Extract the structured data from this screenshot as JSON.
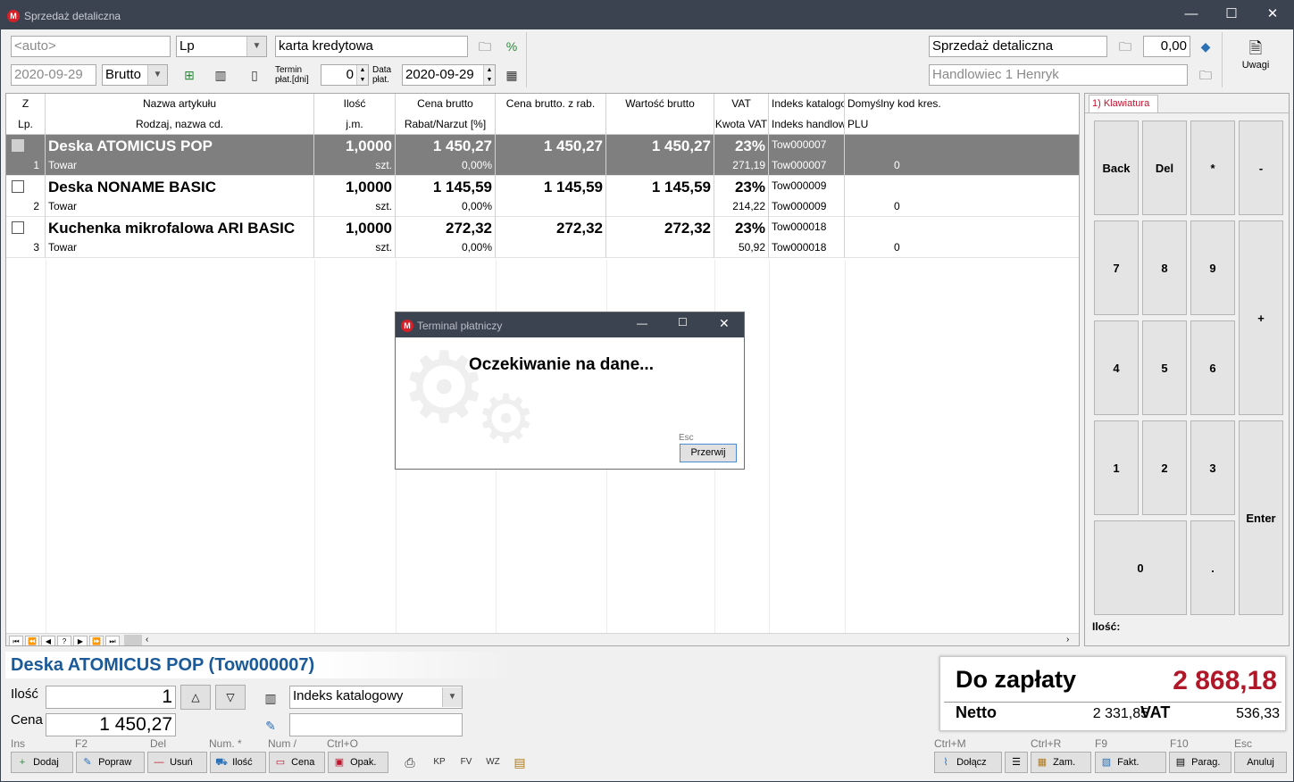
{
  "window": {
    "title": "Sprzedaż detaliczna",
    "logo": "M"
  },
  "header": {
    "number_placeholder": "<auto>",
    "sort_value": "Lp",
    "payment": "karta kredytowa",
    "date": "2020-09-29",
    "price_mode": "Brutto",
    "term_label": "Termin płat.[dni]",
    "term_value": "0",
    "date_pay_label": "Data płat.",
    "date_pay": "2020-09-29",
    "doc_type": "Sprzedaż detaliczna",
    "amount": "0,00",
    "seller": "Handlowiec 1 Henryk",
    "notes_label": "Uwagi"
  },
  "grid": {
    "headers": [
      [
        "Z",
        "Lp."
      ],
      [
        "Nazwa artykułu",
        "Rodzaj, nazwa cd."
      ],
      [
        "Ilość",
        "j.m."
      ],
      [
        "Cena brutto",
        "Rabat/Narzut [%]"
      ],
      [
        "Cena brutto. z rab.",
        ""
      ],
      [
        "Wartość brutto",
        ""
      ],
      [
        "VAT",
        "Kwota VAT"
      ],
      [
        "Indeks katalogowy",
        "Indeks handlowy"
      ],
      [
        "Domyślny kod kres.",
        "PLU"
      ]
    ],
    "rows": [
      {
        "lp": "1",
        "name": "Deska ATOMICUS POP",
        "kind": "Towar",
        "qty": "1,0000",
        "unit": "szt.",
        "price": "1 450,27",
        "disc": "0,00%",
        "price_disc": "1 450,27",
        "value": "1 450,27",
        "vat": "23%",
        "vat_amt": "271,19",
        "idx_cat": "Tow000007",
        "idx_trade": "Tow000007",
        "plu": "0"
      },
      {
        "lp": "2",
        "name": "Deska NONAME BASIC",
        "kind": "Towar",
        "qty": "1,0000",
        "unit": "szt.",
        "price": "1 145,59",
        "disc": "0,00%",
        "price_disc": "1 145,59",
        "value": "1 145,59",
        "vat": "23%",
        "vat_amt": "214,22",
        "idx_cat": "Tow000009",
        "idx_trade": "Tow000009",
        "plu": "0"
      },
      {
        "lp": "3",
        "name": "Kuchenka mikrofalowa ARI BASIC",
        "kind": "Towar",
        "qty": "1,0000",
        "unit": "szt.",
        "price": "272,32",
        "disc": "0,00%",
        "price_disc": "272,32",
        "value": "272,32",
        "vat": "23%",
        "vat_amt": "50,92",
        "idx_cat": "Tow000018",
        "idx_trade": "Tow000018",
        "plu": "0"
      }
    ],
    "nav": [
      "⏮",
      "⏪",
      "◀",
      "?",
      "▶",
      "⏩",
      "⏭"
    ]
  },
  "keypad": {
    "tab": "1) Klawiatura",
    "keys": [
      "Back",
      "Del",
      "*",
      "-",
      "7",
      "8",
      "9",
      "+",
      "4",
      "5",
      "6",
      "1",
      "2",
      "3",
      "Enter",
      "0",
      "."
    ],
    "qty_label": "Ilość:"
  },
  "dialog": {
    "title": "Terminal płatniczy",
    "message": "Oczekiwanie na dane...",
    "esc": "Esc",
    "button": "Przerwij"
  },
  "detail": {
    "title": "Deska ATOMICUS POP (Tow000007)",
    "qty_label": "Ilość",
    "qty": "1",
    "price_label": "Cena",
    "price": "1 450,27",
    "search_mode": "Indeks katalogowy"
  },
  "totals": {
    "due_label": "Do zapłaty",
    "due": "2 868,18",
    "net_label": "Netto",
    "net": "2 331,85",
    "vat_label": "VAT",
    "vat": "536,33"
  },
  "toolbar": {
    "shortcuts": [
      "Ins",
      "F2",
      "Del",
      "Num. *",
      "Num /",
      "Ctrl+O"
    ],
    "buttons": [
      "Dodaj",
      "Popraw",
      "Usuń",
      "Ilość",
      "Cena",
      "Opak."
    ],
    "right_shortcuts": [
      "Ctrl+M",
      "Ctrl+R",
      "F9",
      "F10",
      "Esc"
    ],
    "right_buttons": [
      "Dołącz",
      "Zam.",
      "Fakt.",
      "Parag.",
      "Anuluj"
    ]
  },
  "colors": {
    "titlebar": "#3c4350",
    "selected_row": "#7f7f7f",
    "due": "#b0182a",
    "detail_title": "#1b5a99"
  }
}
